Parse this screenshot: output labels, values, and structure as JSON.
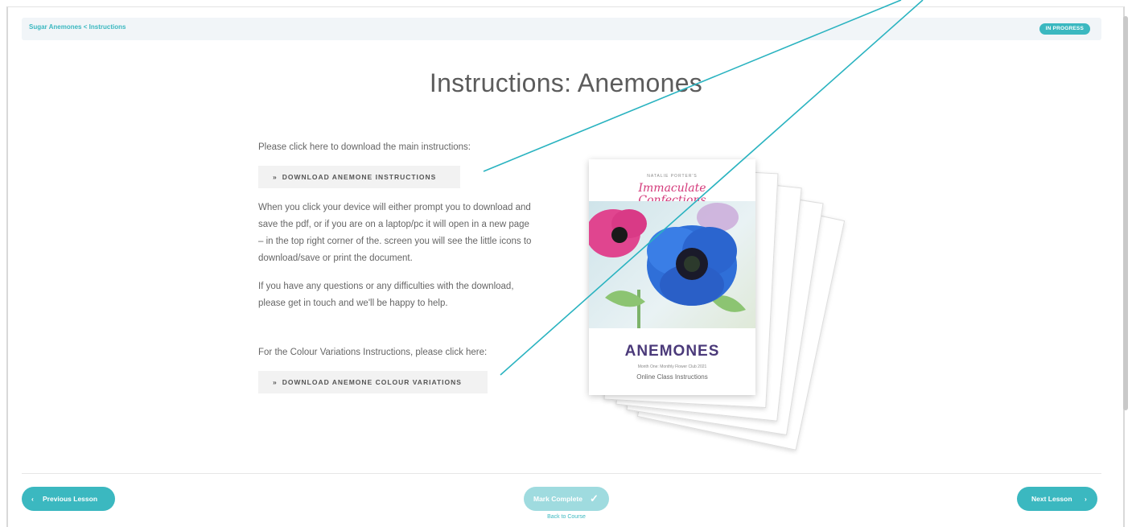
{
  "breadcrumb": {
    "course": "Sugar Anemones",
    "separator": "<",
    "lesson": "Instructions"
  },
  "status_badge": "IN PROGRESS",
  "title": "Instructions: Anemones",
  "content": {
    "intro": "Please click here to download the main instructions:",
    "download_main_label": "DOWNLOAD ANEMONE INSTRUCTIONS",
    "para1_lines": [
      "When you click your device will either prompt you to download and",
      "save the pdf, or if you are on a laptop/pc it will open in a new page",
      "– in the top right corner of the. screen you will see the little icons to",
      "download/save or print the document."
    ],
    "para2_lines": [
      "If you have any questions or any difficulties with the download,",
      "please get in touch and we'll be happy to help."
    ],
    "colour_intro": "For the Colour Variations Instructions, please click here:",
    "download_colour_label": "DOWNLOAD ANEMONE COLOUR VARIATIONS",
    "chevron_glyph": "»"
  },
  "booklet": {
    "logo_small": "NATALIE PORTER'S",
    "logo_line1": "Immaculate",
    "logo_line2": "Confections",
    "heading": "ANEMONES",
    "sub1": "Month One: Monthly Flower Club 2021",
    "sub2": "Online Class Instructions"
  },
  "footer": {
    "prev_label": "Previous Lesson",
    "mark_label": "Mark Complete",
    "back_label": "Back to Course",
    "next_label": "Next Lesson"
  },
  "colors": {
    "accent": "#3bb8c0",
    "annotation": "#2ab3c0",
    "cover_heading": "#4b3a7a"
  }
}
